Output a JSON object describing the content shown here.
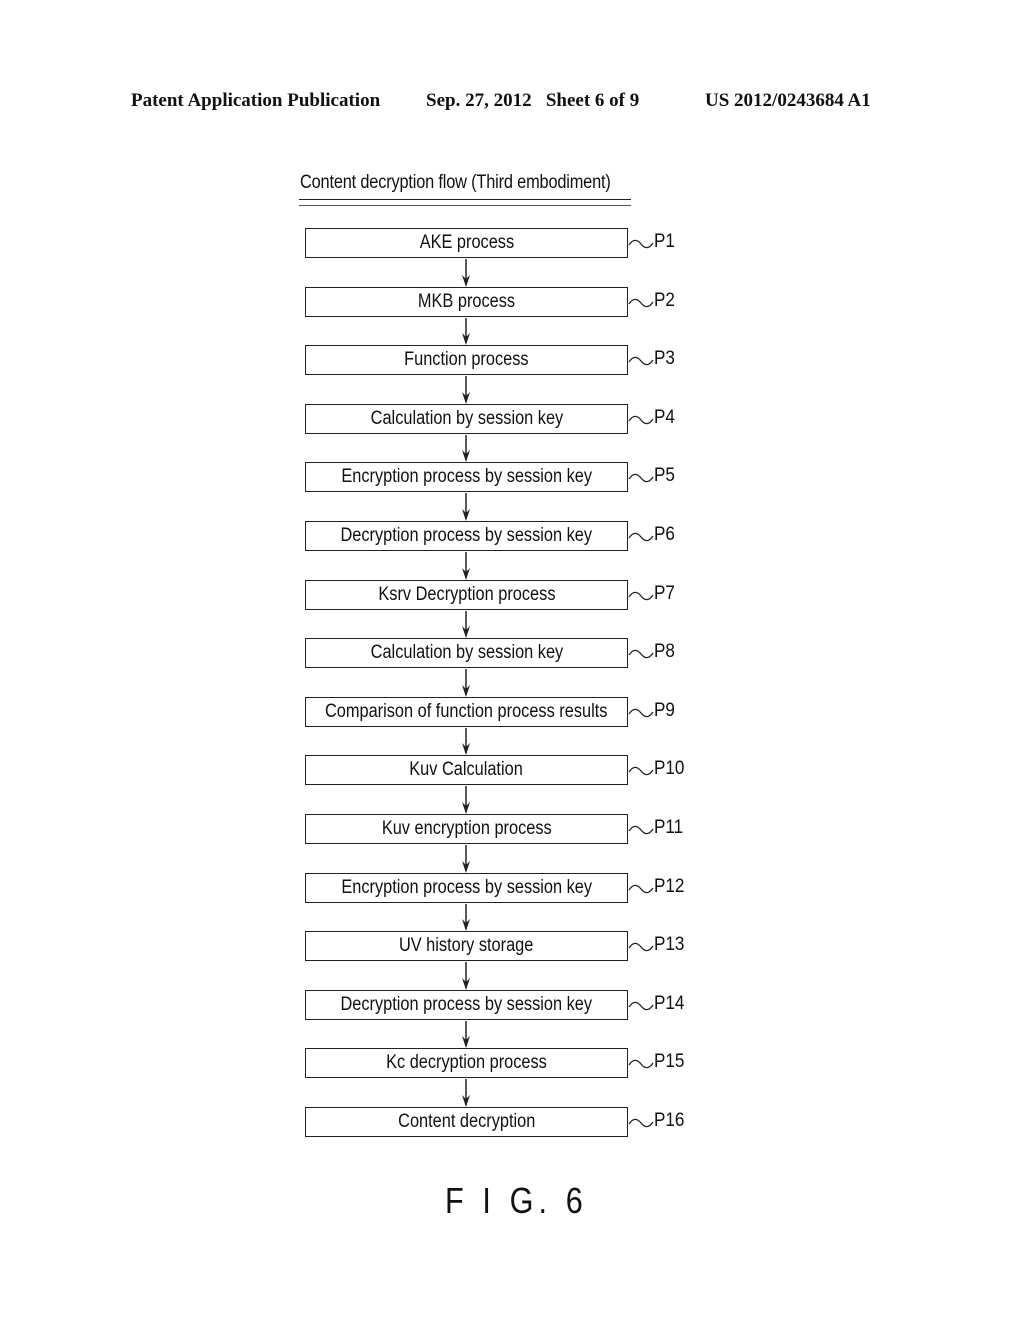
{
  "header": {
    "left": "Patent Application Publication",
    "middle": "Sep. 27, 2012   Sheet 6 of 9",
    "right": "US 2012/0243684 A1"
  },
  "diagram": {
    "title": "Content decryption flow (Third embodiment)",
    "figure_label": "F I G. 6",
    "steps": [
      {
        "label": "AKE process",
        "ref": "P1"
      },
      {
        "label": "MKB process",
        "ref": "P2"
      },
      {
        "label": "Function process",
        "ref": "P3"
      },
      {
        "label": "Calculation by session key",
        "ref": "P4"
      },
      {
        "label": "Encryption process by session key",
        "ref": "P5"
      },
      {
        "label": "Decryption process by session key",
        "ref": "P6"
      },
      {
        "label": "Ksrv Decryption process",
        "ref": "P7"
      },
      {
        "label": "Calculation by session key",
        "ref": "P8"
      },
      {
        "label": "Comparison of function process results",
        "ref": "P9"
      },
      {
        "label": "Kuv Calculation",
        "ref": "P10"
      },
      {
        "label": "Kuv encryption process",
        "ref": "P11"
      },
      {
        "label": "Encryption process by session key",
        "ref": "P12"
      },
      {
        "label": "UV history storage",
        "ref": "P13"
      },
      {
        "label": "Decryption process by session key",
        "ref": "P14"
      },
      {
        "label": "Kc decryption process",
        "ref": "P15"
      },
      {
        "label": "Content decryption",
        "ref": "P16"
      }
    ]
  }
}
